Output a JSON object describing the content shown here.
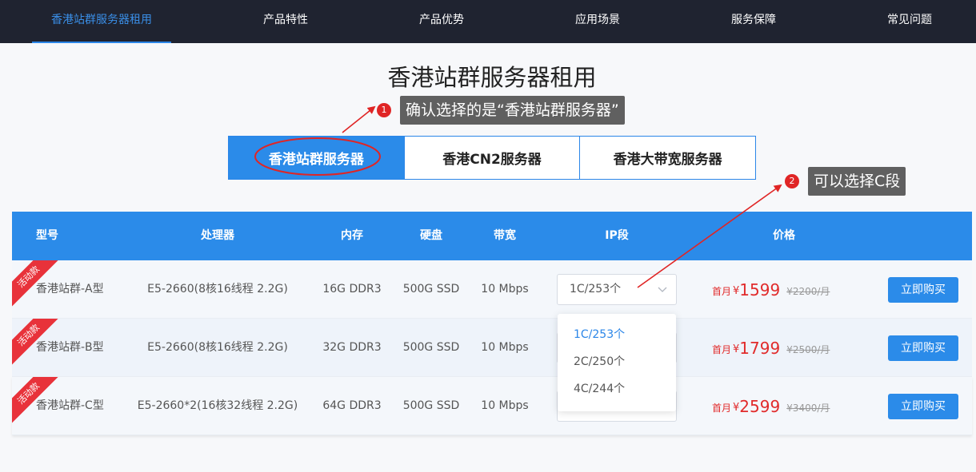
{
  "nav": {
    "items": [
      "香港站群服务器租用",
      "产品特性",
      "产品优势",
      "应用场景",
      "服务保障",
      "常见问题"
    ],
    "active_index": 0,
    "active_color": "#3a8ee6",
    "bg_color": "#1f2330"
  },
  "page_title": "香港站群服务器租用",
  "tabs": {
    "items": [
      "香港站群服务器",
      "香港CN2服务器",
      "香港大带宽服务器"
    ],
    "active_index": 0
  },
  "table": {
    "headers": [
      "型号",
      "处理器",
      "内存",
      "硬盘",
      "带宽",
      "IP段",
      "价格"
    ],
    "rows": [
      {
        "badge": "活动款",
        "model": "香港站群-A型",
        "cpu": "E5-2660(8核16线程 2.2G)",
        "memory": "16G DDR3",
        "disk": "500G SSD",
        "bandwidth": "10 Mbps",
        "ip": "1C/253个",
        "price_prefix": "首月",
        "currency": "¥",
        "price": "1599",
        "original": "¥2200/月",
        "buy": "立即购买"
      },
      {
        "badge": "活动款",
        "model": "香港站群-B型",
        "cpu": "E5-2660(8核16线程 2.2G)",
        "memory": "32G DDR3",
        "disk": "500G SSD",
        "bandwidth": "10 Mbps",
        "ip": "",
        "price_prefix": "首月",
        "currency": "¥",
        "price": "1799",
        "original": "¥2500/月",
        "buy": "立即购买"
      },
      {
        "badge": "活动款",
        "model": "香港站群-C型",
        "cpu": "E5-2660*2(16核32线程 2.2G)",
        "memory": "64G DDR3",
        "disk": "500G SSD",
        "bandwidth": "10 Mbps",
        "ip": "",
        "price_prefix": "首月",
        "currency": "¥",
        "price": "2599",
        "original": "¥3400/月",
        "buy": "立即购买"
      }
    ]
  },
  "ip_dropdown": {
    "options": [
      "1C/253个",
      "2C/250个",
      "4C/244个"
    ],
    "selected_index": 0
  },
  "annotations": [
    {
      "number": "1",
      "text": "确认选择的是“香港站群服务器”"
    },
    {
      "number": "2",
      "text": "可以选择C段"
    }
  ],
  "colors": {
    "accent": "#2b8be9",
    "price": "#e12b2b",
    "ribbon": "#e8323a",
    "annotation": "#e02525",
    "callout_bg": "#606060"
  },
  "icons": {
    "select_arrow": "chevron-down-icon"
  }
}
